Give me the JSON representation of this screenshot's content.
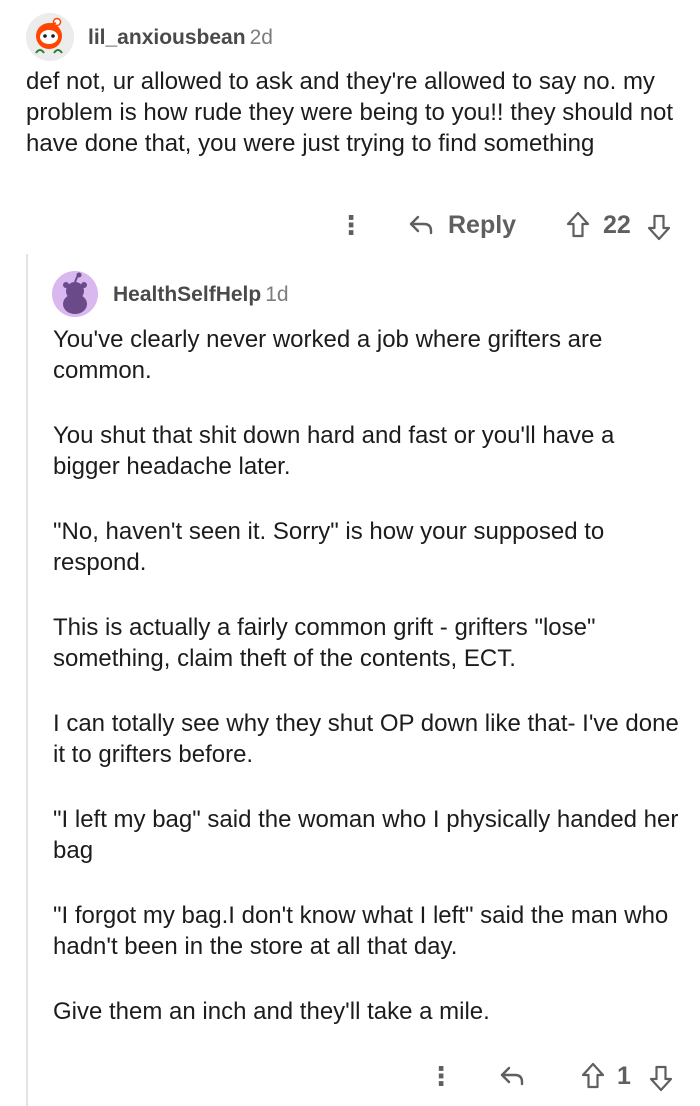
{
  "top_comment": {
    "username": "lil_anxiousbean",
    "age": "2d",
    "body": "def not, ur allowed to ask and they're allowed to say no. my problem is how rude they were being to you!! they should not have done that, you were just trying to find something",
    "reply_label": "Reply",
    "score": "22"
  },
  "reply_comment": {
    "username": "HealthSelfHelp",
    "age": "1d",
    "paragraphs": [
      "You've clearly never worked a job where grifters are common.",
      "You shut that shit down hard and fast or you'll have a bigger headache later.",
      "\"No, haven't seen it. Sorry\" is how your supposed to respond.",
      "This is actually a fairly common grift - grifters \"lose\" something, claim theft of the contents, ECT.",
      "I can totally see why they shut OP down like that- I've done it to grifters before.",
      "\"I left my bag\" said the woman who I physically handed her bag",
      "\"I forgot my bag.I don't know what I left\" said the man who hadn't been in the store at all that day.",
      "Give them an inch and they'll take a mile."
    ],
    "score": "1"
  },
  "icons": {
    "more": "more-options-icon",
    "reply": "reply-arrow-icon",
    "upvote": "upvote-arrow-icon",
    "downvote": "downvote-arrow-icon"
  },
  "colors": {
    "text": "#1c1c1c",
    "meta": "#7c7c7c",
    "action": "#5f5f60",
    "thread_line": "#e4e4e4",
    "reply_avatar_bg": "#d9b8f0"
  }
}
